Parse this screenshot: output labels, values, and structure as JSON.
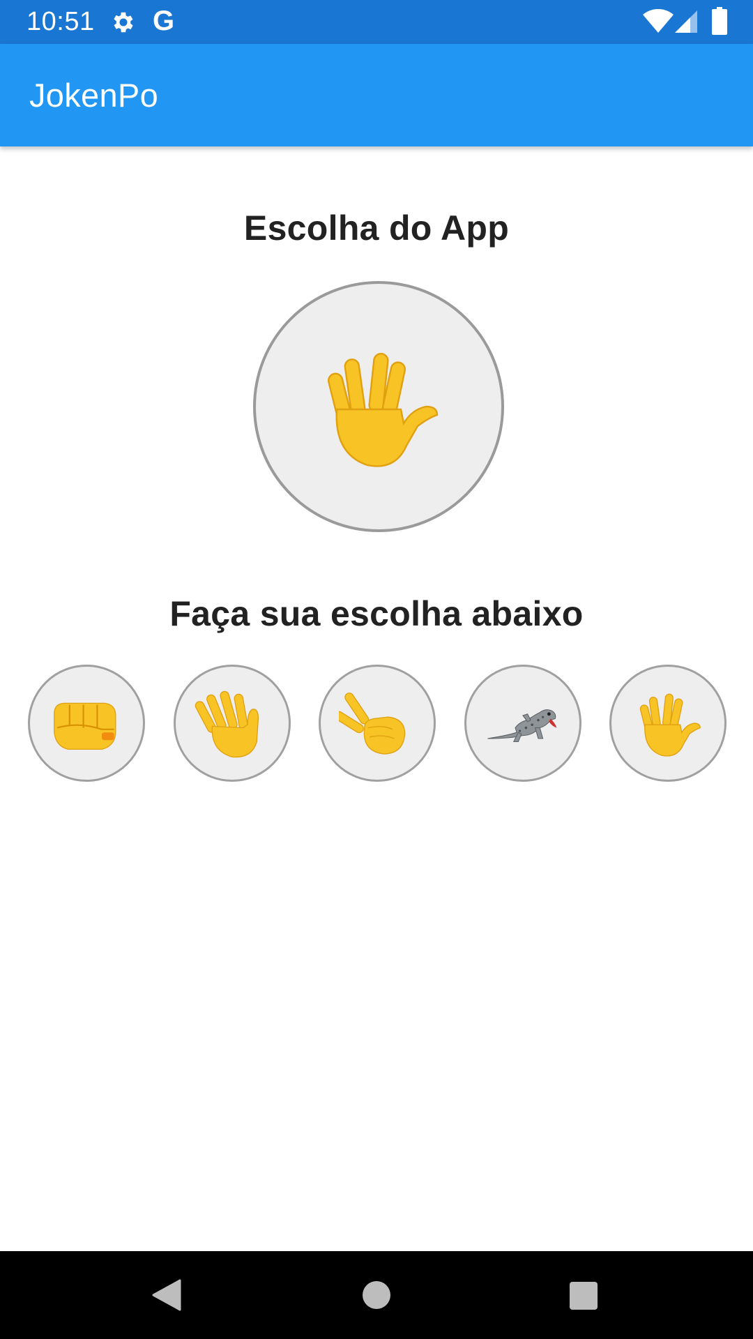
{
  "status_bar": {
    "time": "10:51",
    "g_label": "G",
    "icons": [
      "gear-icon",
      "google-g-icon",
      "wifi-icon",
      "signal-icon",
      "battery-icon"
    ],
    "color": "#1976d2"
  },
  "app_bar": {
    "title": "JokenPo",
    "color": "#2196f3"
  },
  "app_choice": {
    "heading": "Escolha do App",
    "current": "spock-hand-icon"
  },
  "user_choice": {
    "heading": "Faça sua escolha abaixo",
    "options": [
      {
        "name": "rock",
        "icon": "fist-icon"
      },
      {
        "name": "paper",
        "icon": "open-hand-icon"
      },
      {
        "name": "scissors",
        "icon": "victory-hand-icon"
      },
      {
        "name": "lizard",
        "icon": "lizard-icon"
      },
      {
        "name": "spock",
        "icon": "spock-hand-icon"
      }
    ]
  },
  "nav_bar": {
    "icons": [
      "back-icon",
      "home-icon",
      "recents-icon"
    ]
  }
}
